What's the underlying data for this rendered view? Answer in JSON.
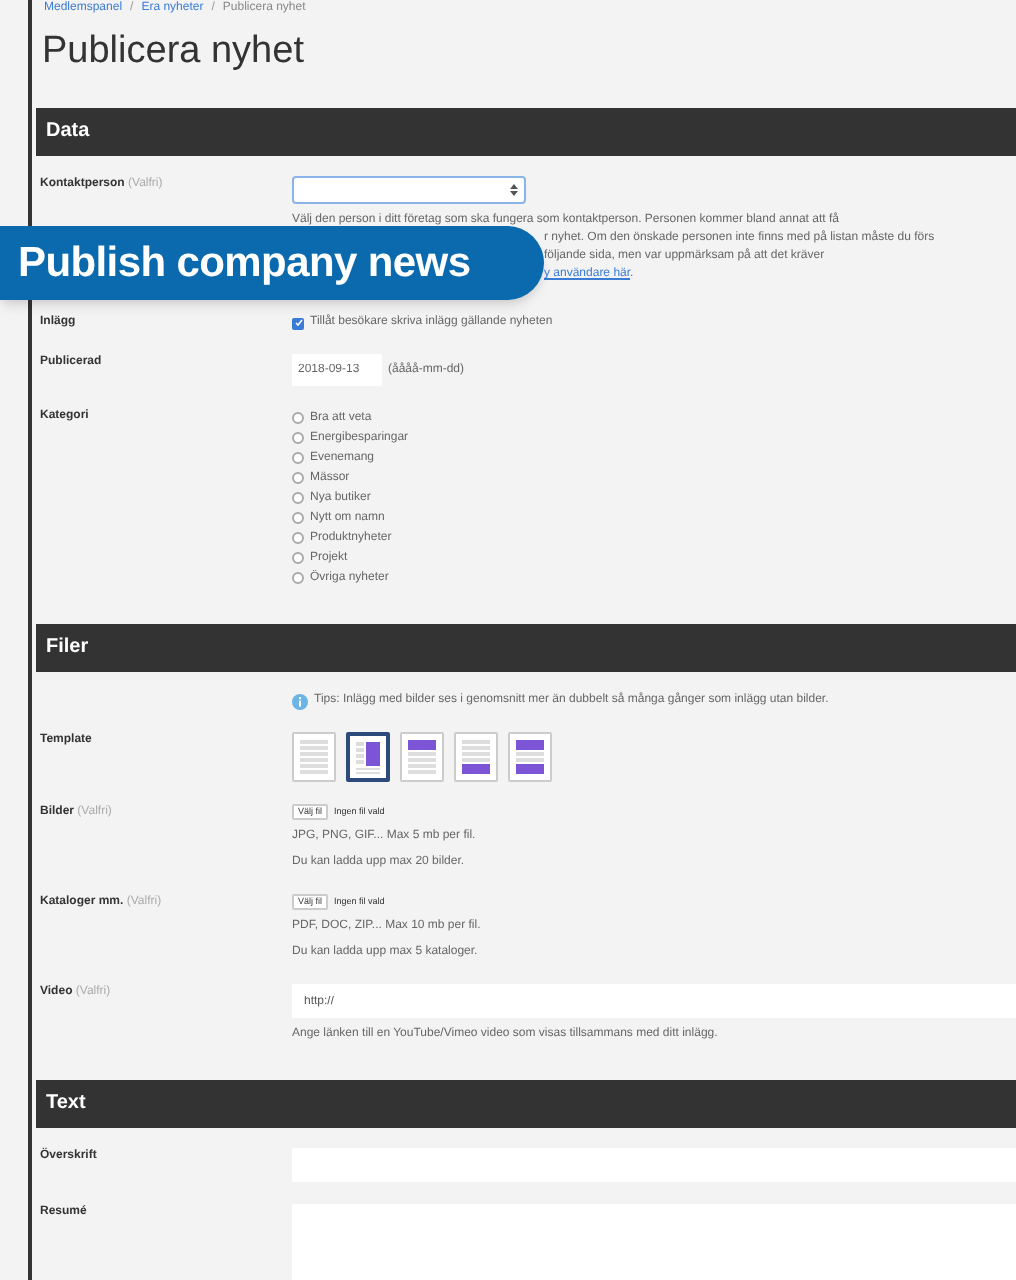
{
  "breadcrumb": [
    "Medlemspanel",
    "Era nyheter",
    "Publicera nyhet"
  ],
  "breadcrumb_separator": "/",
  "title": "Publicera nyhet",
  "banner": "Publish company news",
  "sections": [
    {
      "title": "Data",
      "rows": [
        {
          "kind": "select",
          "label": "Kontaktperson",
          "optional": "(Valfri)",
          "help": [
            {
              "text": "Välj den person i ditt företag som ska fungera som kontaktperson. Personen kommer bland annat att få"
            },
            {
              "text": "r nyhet. Om den önskade personen inte finns med på listan måste du förs"
            },
            {
              "text": "följande sida, men var uppmärksam på att det kräver"
            },
            {
              "link": "y användare här",
              "after": "."
            }
          ]
        },
        {
          "kind": "checkbox",
          "label": "Inlägg",
          "text": "Tillåt besökare skriva inlägg gällande nyheten",
          "checked": true
        },
        {
          "kind": "date",
          "label": "Publicerad",
          "value": "2018-09-13",
          "hint": "(åååå-mm-dd)"
        },
        {
          "kind": "radios",
          "label": "Kategori",
          "options": [
            {
              "label": "Bra att veta",
              "selected": false
            },
            {
              "label": "Energibesparingar",
              "selected": false
            },
            {
              "label": "Evenemang",
              "selected": false
            },
            {
              "label": "Mässor",
              "selected": false
            },
            {
              "label": "Nya butiker",
              "selected": false
            },
            {
              "label": "Nytt om namn",
              "selected": false
            },
            {
              "label": "Produktnyheter",
              "selected": false
            },
            {
              "label": "Projekt",
              "selected": false
            },
            {
              "label": "Övriga nyheter",
              "selected": false
            }
          ]
        }
      ]
    },
    {
      "title": "Filer",
      "rows": [
        {
          "kind": "tip",
          "text": "Tips: Inlägg med bilder ses i genomsnitt mer än dubbelt så många gånger som inlägg utan bilder."
        },
        {
          "kind": "templates",
          "label": "Template",
          "templates": [
            {
              "kind": "plain",
              "selected": false
            },
            {
              "kind": "right",
              "selected": true
            },
            {
              "kind": "top",
              "selected": false
            },
            {
              "kind": "bottom",
              "selected": false
            },
            {
              "kind": "topbottom",
              "selected": false
            }
          ]
        },
        {
          "kind": "file",
          "label": "Bilder",
          "optional": "(Valfri)",
          "button": "Välj fil",
          "status": "Ingen fil vald",
          "notes": [
            "JPG, PNG, GIF... Max 5 mb per fil.",
            "Du kan ladda upp max 20 bilder."
          ]
        },
        {
          "kind": "file",
          "label": "Kataloger mm.",
          "optional": "(Valfri)",
          "button": "Välj fil",
          "status": "Ingen fil vald",
          "notes": [
            "PDF, DOC, ZIP... Max 10 mb per fil.",
            "Du kan ladda upp max 5 kataloger."
          ]
        },
        {
          "kind": "text",
          "label": "Video",
          "optional": "(Valfri)",
          "value": "http://",
          "help": "Ange länken till en YouTube/Vimeo video som visas tillsammans med ditt inlägg."
        }
      ]
    },
    {
      "title": "Text",
      "rows": [
        {
          "kind": "text",
          "label": "Överskrift"
        },
        {
          "kind": "textarea",
          "label": "Resumé"
        }
      ]
    }
  ]
}
